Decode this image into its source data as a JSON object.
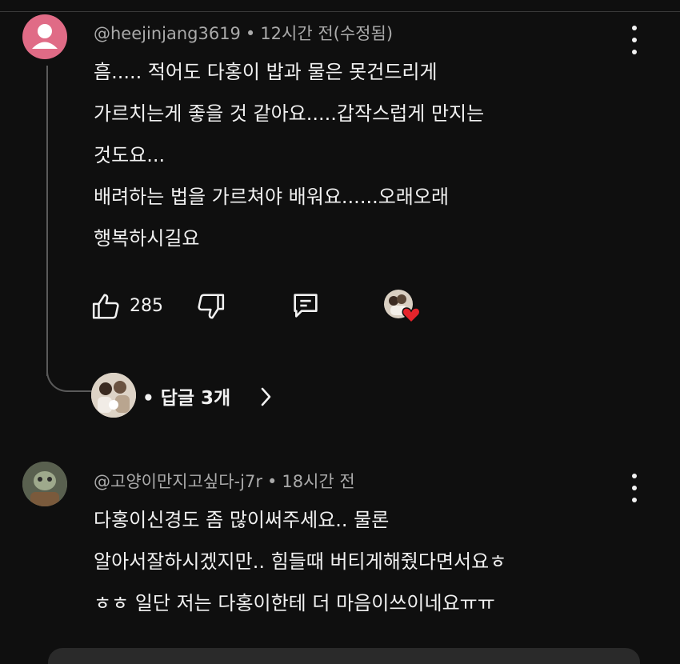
{
  "comments": [
    {
      "author": "@heejinjang3619",
      "time": "12시간 전(수정됨)",
      "lines": [
        "흠..... 적어도 다홍이 밥과 물은 못건드리게",
        "가르치는게 좋을 것 같아요.....갑작스럽게 만지는",
        "것도요...",
        "배려하는 법을 가르쳐야  배워요......오래오래",
        "행복하시길요"
      ],
      "likes": "285",
      "replies_label": "답글 3개"
    },
    {
      "author": "@고양이만지고싶다-j7r",
      "time": "18시간 전",
      "lines": [
        "다홍이신경도 좀 많이써주세요.. 물론",
        "알아서잘하시겠지만.. 힘들때 버티게해줬다면서요ㅎ",
        "ㅎㅎ 일단 저는 다홍이한테 더 마음이쓰이네요ㅠㅠ"
      ]
    }
  ],
  "separator": "•",
  "icons": {
    "like": "thumb-up-icon",
    "dislike": "thumb-down-icon",
    "reply": "comment-icon",
    "more": "more-vert-icon",
    "heart": "heart-icon",
    "chevron": "chevron-right-icon"
  },
  "colors": {
    "background": "#0f0f0f",
    "meta_text": "#aaaaaa",
    "heart": "#e5242b",
    "avatar_default": "#e06b86"
  }
}
